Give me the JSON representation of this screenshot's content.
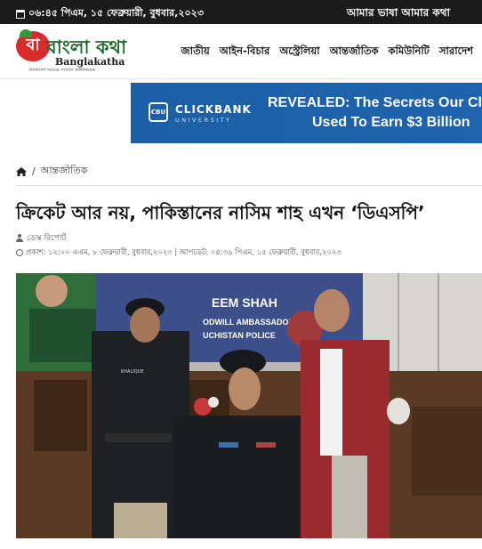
{
  "topbar": {
    "date": "০৬:৪৫ পিএম, ১৫ ফেব্রুয়ারী, বুধবার,২০২৩",
    "slogan": "আমার ভাষা আমার কথা"
  },
  "logo": {
    "bn_text": "বাংলা কথা",
    "en_text": "Banglakatha",
    "tagline": "বাংলাদেশ সময়ের সংবাদে অঙ্গীকারবদ্ধ"
  },
  "nav": {
    "items": [
      "জাতীয়",
      "আইন-বিচার",
      "অস্ট্রেলিয়া",
      "আন্তর্জাতিক",
      "কমিউনিটি",
      "সারাদেশ"
    ]
  },
  "ad": {
    "logo_text": "CBU",
    "brand": "CLICKBANK",
    "brand_sub": "UNIVERSITY",
    "headline_1": "REVEALED: The Secrets Our Cl",
    "headline_2": "Used To Earn $3 Billion"
  },
  "breadcrumb": {
    "separator": "/",
    "category": "আন্তর্জাতিক"
  },
  "article": {
    "title": "ক্রিকেট আর নয়, পাকিস্তানের নাসিম শাহ এখন ‘ডিএসপি’",
    "author": "ডেস্ক রিপোর্ট",
    "meta": "প্রকাশ: ১২:০০ এএম, ৮ ফেব্রুয়ারী, বুধবার,২০২৩ | আপডেট: ০৪:৩৯ পিএম, ১৫ ফেব্রুয়ারী, বুধবার,২০২৩"
  },
  "photo": {
    "banner_line_1": "EEM SHAH",
    "banner_line_2": "ODWILL AMBASSADOR",
    "banner_line_3": "UCHISTAN POLICE",
    "name_tag": "KHALIQUE"
  },
  "colors": {
    "topbar": "#1b1b1b",
    "ad_bg": "#1d63ad",
    "logo_red": "#d92b2b",
    "logo_green": "#1e6d2b"
  }
}
